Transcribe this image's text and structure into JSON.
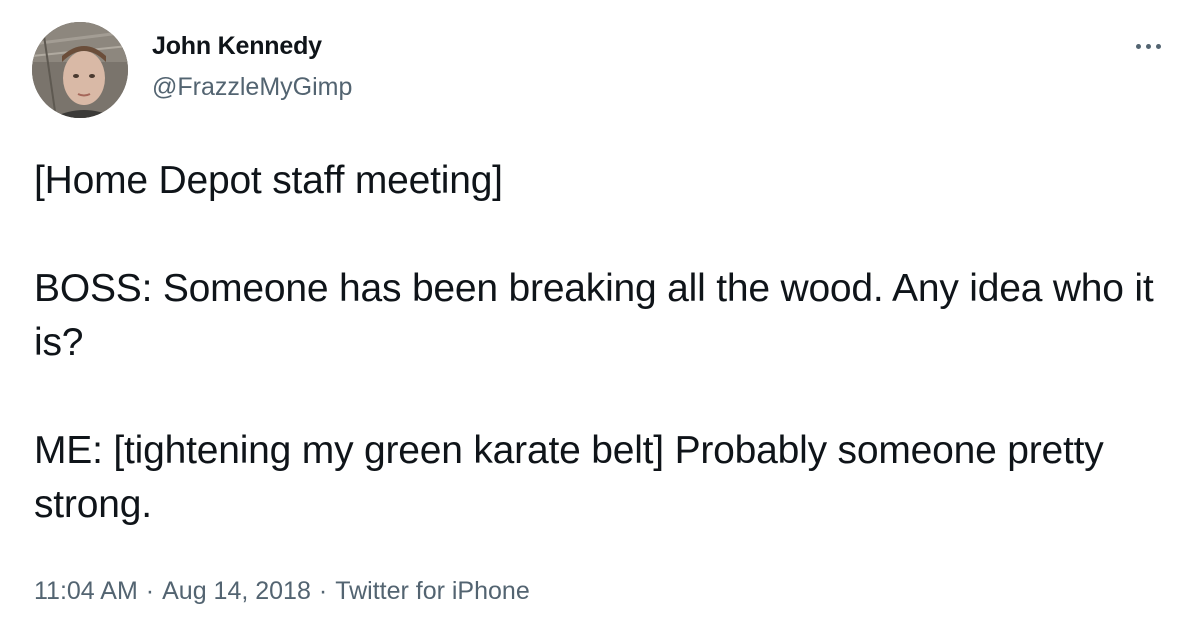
{
  "author": {
    "name": "John Kennedy",
    "handle": "@FrazzleMyGimp"
  },
  "icons": {
    "avatar": "profile-photo",
    "more": "more-horizontal-icon"
  },
  "tweet": {
    "paragraphs": [
      "[Home Depot staff meeting]",
      "BOSS: Someone has been breaking all the wood. Any idea who it is?",
      "ME: [tightening my green karate belt] Probably someone pretty strong."
    ]
  },
  "meta": {
    "time": "11:04 AM",
    "separator": "·",
    "date": "Aug 14, 2018",
    "source": "Twitter for iPhone"
  },
  "colors": {
    "text": "#0f1419",
    "secondary": "#536471",
    "background": "#ffffff"
  }
}
